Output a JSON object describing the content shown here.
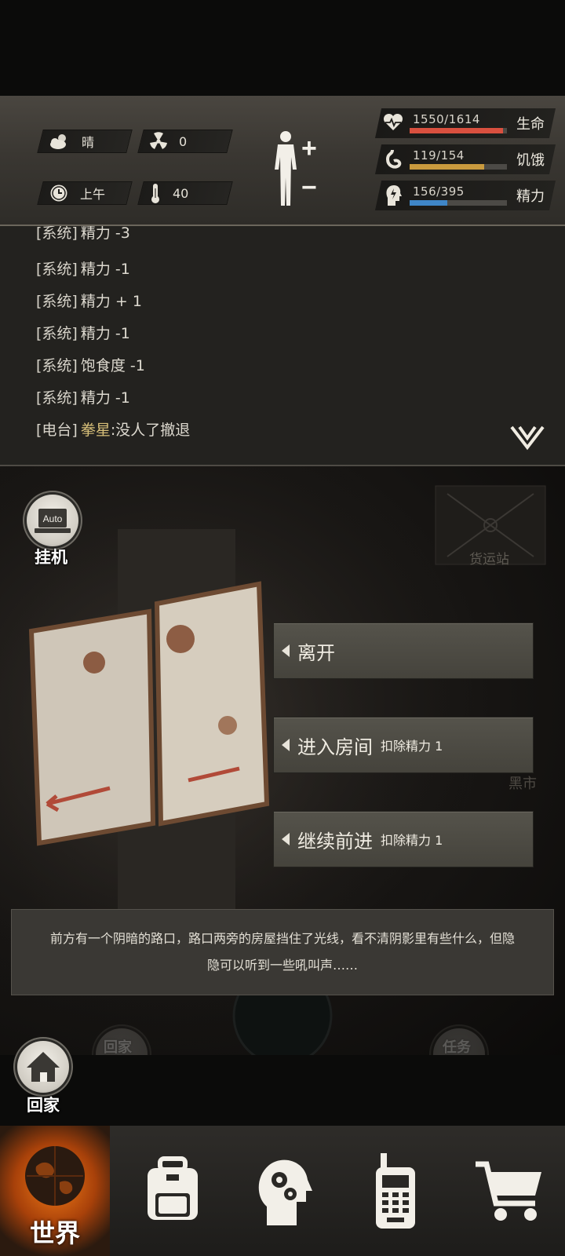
{
  "status": {
    "weather": {
      "icon": "cloud-sun-icon",
      "label": "晴"
    },
    "radiation": {
      "icon": "radiation-icon",
      "value": "0"
    },
    "time": {
      "icon": "clock-icon",
      "label": "上午"
    },
    "temperature": {
      "icon": "thermometer-icon",
      "value": "40"
    },
    "body": {
      "icon": "body-silhouette-icon",
      "plus": "+",
      "minus": "−"
    },
    "vitals": [
      {
        "key": "health",
        "icon": "heart-icon",
        "text": "1550/1614",
        "fraction": 0.96,
        "color": "#d9503f",
        "label": "生命"
      },
      {
        "key": "hunger",
        "icon": "stomach-icon",
        "text": "119/154",
        "fraction": 0.77,
        "color": "#c99a3e",
        "label": "饥饿"
      },
      {
        "key": "energy",
        "icon": "energy-head-icon",
        "text": "156/395",
        "fraction": 0.39,
        "color": "#3f86c8",
        "label": "精力"
      }
    ]
  },
  "log": {
    "lines": [
      {
        "tag": "[系统]",
        "text": "精力 -3",
        "highlight": ""
      },
      {
        "tag": "[系统]",
        "text": "精力 -1",
        "highlight": ""
      },
      {
        "tag": "[系统]",
        "text": "精力 + 1",
        "highlight": ""
      },
      {
        "tag": "[系统]",
        "text": "精力 -1",
        "highlight": ""
      },
      {
        "tag": "[系统]",
        "text": "饱食度 -1",
        "highlight": ""
      },
      {
        "tag": "[系统]",
        "text": "精力 -1",
        "highlight": ""
      },
      {
        "tag": "[电台]",
        "highlight": "拳星",
        "text": ":没人了撤退"
      }
    ],
    "expand_icon": "double-chevron-down-icon"
  },
  "scene": {
    "auto": {
      "badge": "Auto",
      "label": "挂机"
    },
    "bg_freight": "货运站",
    "bg_blackmarket": "黑市",
    "choices": [
      {
        "label": "离开",
        "cost": ""
      },
      {
        "label": "进入房间",
        "cost": "扣除精力 1"
      },
      {
        "label": "继续前进",
        "cost": "扣除精力 1"
      }
    ],
    "description": "前方有一个阴暗的路口，路口两旁的房屋挡住了光线，看不清阴影里有些什么，但隐隐可以听到一些吼叫声……",
    "home": {
      "label": "回家"
    },
    "bg_home": "回家",
    "bg_quest": "任务"
  },
  "nav": {
    "world": {
      "label": "世界",
      "icon": "globe-icon"
    },
    "backpack": {
      "icon": "backpack-icon"
    },
    "skills": {
      "icon": "head-gears-icon"
    },
    "radio": {
      "icon": "walkie-talkie-icon"
    },
    "shop": {
      "icon": "shopping-cart-icon"
    }
  }
}
